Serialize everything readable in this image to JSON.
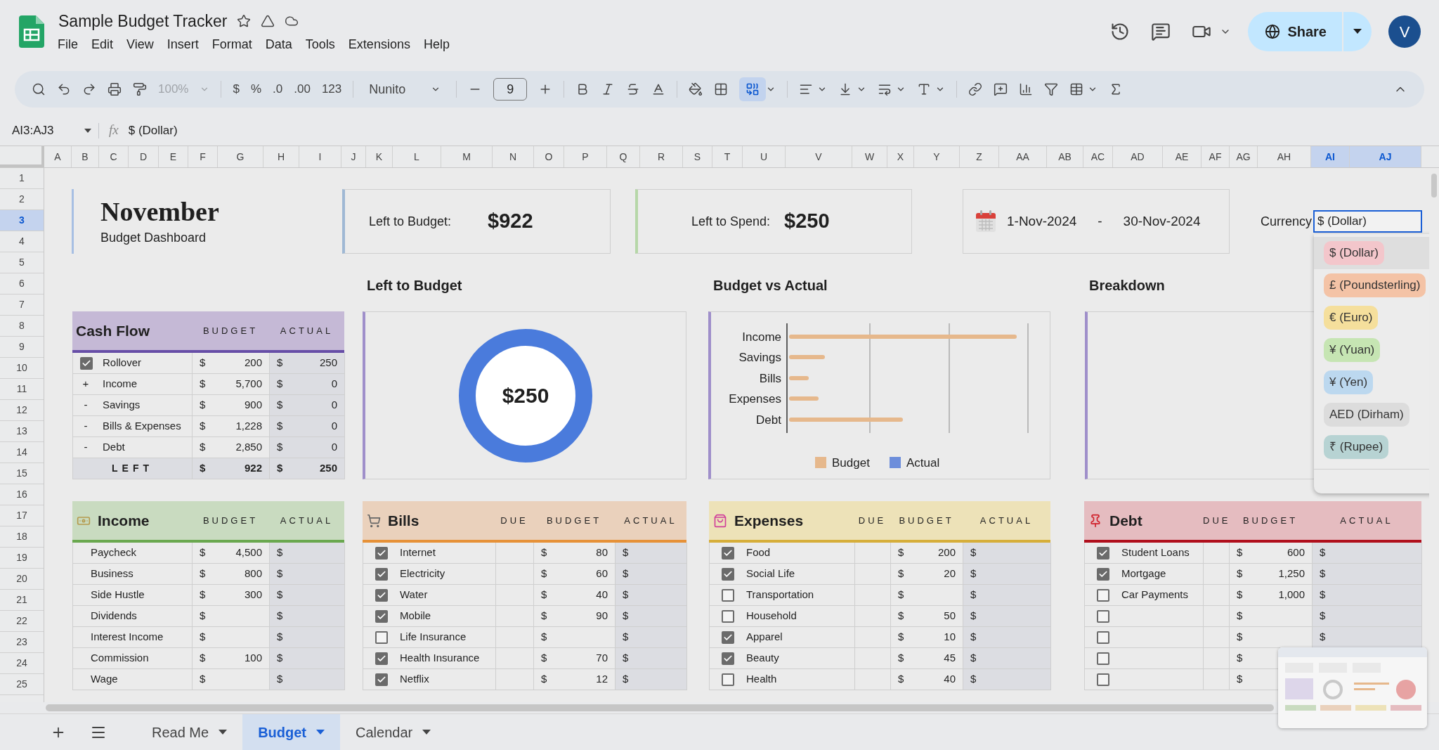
{
  "app": {
    "title": "Sample Budget Tracker",
    "menu": [
      "File",
      "Edit",
      "View",
      "Insert",
      "Format",
      "Data",
      "Tools",
      "Extensions",
      "Help"
    ],
    "share": "Share",
    "avatar": "V"
  },
  "toolbar": {
    "zoom": "100%",
    "currency": "$",
    "percent": "%",
    "decrease_decimals": ".0",
    "increase_decimals": ".00",
    "number_format": "123",
    "font": "Nunito",
    "font_size": "9",
    "merge_active": true
  },
  "formula_bar": {
    "name_box": "AI3:AJ3",
    "fx": "fx",
    "value": "$ (Dollar)"
  },
  "columns": [
    {
      "label": "A",
      "selected": false
    },
    {
      "label": "B",
      "selected": false
    },
    {
      "label": "C",
      "selected": false
    },
    {
      "label": "D",
      "selected": false
    },
    {
      "label": "E",
      "selected": false
    },
    {
      "label": "F",
      "selected": false
    },
    {
      "label": "G",
      "selected": false
    },
    {
      "label": "H",
      "selected": false
    },
    {
      "label": "I",
      "selected": false
    },
    {
      "label": "J",
      "selected": false
    },
    {
      "label": "K",
      "selected": false
    },
    {
      "label": "L",
      "selected": false
    },
    {
      "label": "M",
      "selected": false
    },
    {
      "label": "N",
      "selected": false
    },
    {
      "label": "O",
      "selected": false
    },
    {
      "label": "P",
      "selected": false
    },
    {
      "label": "Q",
      "selected": false
    },
    {
      "label": "R",
      "selected": false
    },
    {
      "label": "S",
      "selected": false
    },
    {
      "label": "T",
      "selected": false
    },
    {
      "label": "U",
      "selected": false
    },
    {
      "label": "V",
      "selected": false
    },
    {
      "label": "W",
      "selected": false
    },
    {
      "label": "X",
      "selected": false
    },
    {
      "label": "Y",
      "selected": false
    },
    {
      "label": "Z",
      "selected": false
    },
    {
      "label": "AA",
      "selected": false
    },
    {
      "label": "AB",
      "selected": false
    },
    {
      "label": "AC",
      "selected": false
    },
    {
      "label": "AD",
      "selected": false
    },
    {
      "label": "AE",
      "selected": false
    },
    {
      "label": "AF",
      "selected": false
    },
    {
      "label": "AG",
      "selected": false
    },
    {
      "label": "AH",
      "selected": false
    },
    {
      "label": "AI",
      "selected": true
    },
    {
      "label": "AJ",
      "selected": true
    }
  ],
  "rows": [
    {
      "label": "1",
      "selected": false
    },
    {
      "label": "2",
      "selected": false
    },
    {
      "label": "3",
      "selected": true
    },
    {
      "label": "4",
      "selected": false
    },
    {
      "label": "5",
      "selected": false
    },
    {
      "label": "6",
      "selected": false
    },
    {
      "label": "7",
      "selected": false
    },
    {
      "label": "8",
      "selected": false
    },
    {
      "label": "9",
      "selected": false
    },
    {
      "label": "10",
      "selected": false
    },
    {
      "label": "11",
      "selected": false
    },
    {
      "label": "12",
      "selected": false
    },
    {
      "label": "13",
      "selected": false
    },
    {
      "label": "14",
      "selected": false
    },
    {
      "label": "15",
      "selected": false
    },
    {
      "label": "16",
      "selected": false
    },
    {
      "label": "17",
      "selected": false
    },
    {
      "label": "18",
      "selected": false
    },
    {
      "label": "19",
      "selected": false
    },
    {
      "label": "20",
      "selected": false
    },
    {
      "label": "21",
      "selected": false
    },
    {
      "label": "22",
      "selected": false
    },
    {
      "label": "23",
      "selected": false
    },
    {
      "label": "24",
      "selected": false
    },
    {
      "label": "25",
      "selected": false
    }
  ],
  "dashboard": {
    "title": "November",
    "subtitle": "Budget Dashboard",
    "summary_cards": [
      {
        "label": "Left to Budget:",
        "value": "$922",
        "color": "#9fb8d4"
      },
      {
        "label": "Left to Spend:",
        "value": "$250",
        "color": "#b6d7a8"
      }
    ],
    "date_range": {
      "start": "1-Nov-2024",
      "separator": "-",
      "end": "30-Nov-2024"
    },
    "currency": {
      "label": "Currency",
      "value": "$ (Dollar)",
      "options": [
        {
          "label": "$ (Dollar)",
          "color": "#f3c6cb",
          "selected": true
        },
        {
          "label": "£ (Poundsterling)",
          "color": "#f4c3a6",
          "selected": false
        },
        {
          "label": "€ (Euro)",
          "color": "#f5df9c",
          "selected": false
        },
        {
          "label": "¥ (Yuan)",
          "color": "#c6e5b3",
          "selected": false
        },
        {
          "label": "¥ (Yen)",
          "color": "#bcd8ef",
          "selected": false
        },
        {
          "label": "AED (Dirham)",
          "color": "#dcdcdc",
          "selected": false
        },
        {
          "label": "₹ (Rupee)",
          "color": "#b7d3d3",
          "selected": false
        }
      ]
    },
    "section_titles": [
      "Left to Budget",
      "Budget vs Actual",
      "Breakdown"
    ],
    "cash_flow": {
      "title": "Cash Flow",
      "columns": [
        "BUDGET",
        "ACTUAL"
      ],
      "rows": [
        {
          "kind": "checkbox",
          "checked": true,
          "label": "Rollover",
          "budget_sym": "$",
          "budget": "200",
          "actual_sym": "$",
          "actual": "250"
        },
        {
          "kind": "sign",
          "sign": "+",
          "label": "Income",
          "budget_sym": "$",
          "budget": "5,700",
          "actual_sym": "$",
          "actual": "0"
        },
        {
          "kind": "sign",
          "sign": "-",
          "label": "Savings",
          "budget_sym": "$",
          "budget": "900",
          "actual_sym": "$",
          "actual": "0"
        },
        {
          "kind": "sign",
          "sign": "-",
          "label": "Bills & Expenses",
          "budget_sym": "$",
          "budget": "1,228",
          "actual_sym": "$",
          "actual": "0"
        },
        {
          "kind": "sign",
          "sign": "-",
          "label": "Debt",
          "budget_sym": "$",
          "budget": "2,850",
          "actual_sym": "$",
          "actual": "0"
        },
        {
          "kind": "total",
          "label": "LEFT",
          "budget_sym": "$",
          "budget": "922",
          "actual_sym": "$",
          "actual": "250"
        }
      ]
    },
    "donut": {
      "center": "$250"
    },
    "budget_vs_actual": {
      "categories": [
        "Income",
        "Savings",
        "Bills",
        "Expenses",
        "Debt"
      ],
      "legend": [
        {
          "label": "Budget",
          "color": "#e6b88c"
        },
        {
          "label": "Actual",
          "color": "#6d8edb"
        }
      ]
    },
    "tables": [
      {
        "kind": "income",
        "title": "Income",
        "color": "#c9dbc0",
        "columns": [
          "BUDGET",
          "ACTUAL"
        ],
        "rows": [
          {
            "label": "Paycheck",
            "budget_sym": "$",
            "budget": "4,500",
            "actual_sym": "$"
          },
          {
            "label": "Business",
            "budget_sym": "$",
            "budget": "800",
            "actual_sym": "$"
          },
          {
            "label": "Side Hustle",
            "budget_sym": "$",
            "budget": "300",
            "actual_sym": "$"
          },
          {
            "label": "Dividends",
            "budget_sym": "$",
            "actual_sym": "$"
          },
          {
            "label": "Interest Income",
            "budget_sym": "$",
            "actual_sym": "$"
          },
          {
            "label": "Commission",
            "budget_sym": "$",
            "budget": "100",
            "actual_sym": "$"
          },
          {
            "label": "Wage",
            "budget_sym": "$",
            "actual_sym": "$"
          }
        ]
      },
      {
        "kind": "bills",
        "title": "Bills",
        "color": "#ead1bc",
        "columns": [
          "DUE",
          "BUDGET",
          "ACTUAL"
        ],
        "rows": [
          {
            "checked": true,
            "label": "Internet",
            "budget_sym": "$",
            "budget": "80",
            "actual_sym": "$"
          },
          {
            "checked": true,
            "label": "Electricity",
            "budget_sym": "$",
            "budget": "60",
            "actual_sym": "$"
          },
          {
            "checked": true,
            "label": "Water",
            "budget_sym": "$",
            "budget": "40",
            "actual_sym": "$"
          },
          {
            "checked": true,
            "label": "Mobile",
            "budget_sym": "$",
            "budget": "90",
            "actual_sym": "$"
          },
          {
            "checked": false,
            "label": "Life Insurance",
            "budget_sym": "$",
            "actual_sym": "$"
          },
          {
            "checked": true,
            "label": "Health Insurance",
            "budget_sym": "$",
            "budget": "70",
            "actual_sym": "$"
          },
          {
            "checked": true,
            "label": "Netflix",
            "budget_sym": "$",
            "budget": "12",
            "actual_sym": "$"
          }
        ]
      },
      {
        "kind": "expenses",
        "title": "Expenses",
        "color": "#ede2b8",
        "columns": [
          "DUE",
          "BUDGET",
          "ACTUAL"
        ],
        "rows": [
          {
            "checked": true,
            "label": "Food",
            "budget_sym": "$",
            "budget": "200",
            "actual_sym": "$"
          },
          {
            "checked": true,
            "label": "Social Life",
            "budget_sym": "$",
            "budget": "20",
            "actual_sym": "$"
          },
          {
            "checked": false,
            "label": "Transportation",
            "budget_sym": "$",
            "actual_sym": "$"
          },
          {
            "checked": false,
            "label": "Household",
            "budget_sym": "$",
            "budget": "50",
            "actual_sym": "$"
          },
          {
            "checked": true,
            "label": "Apparel",
            "budget_sym": "$",
            "budget": "10",
            "actual_sym": "$"
          },
          {
            "checked": true,
            "label": "Beauty",
            "budget_sym": "$",
            "budget": "45",
            "actual_sym": "$"
          },
          {
            "checked": false,
            "label": "Health",
            "budget_sym": "$",
            "budget": "40",
            "actual_sym": "$"
          }
        ]
      },
      {
        "kind": "debt",
        "title": "Debt",
        "color": "#e5bcc0",
        "columns": [
          "DUE",
          "BUDGET",
          "ACTUAL"
        ],
        "rows": [
          {
            "checked": true,
            "label": "Student Loans",
            "budget_sym": "$",
            "budget": "600",
            "actual_sym": "$"
          },
          {
            "checked": true,
            "label": "Mortgage",
            "budget_sym": "$",
            "budget": "1,250",
            "actual_sym": "$"
          },
          {
            "checked": false,
            "label": "Car Payments",
            "budget_sym": "$",
            "budget": "1,000",
            "actual_sym": "$"
          },
          {
            "checked": false,
            "budget_sym": "$",
            "actual_sym": "$"
          },
          {
            "checked": false,
            "budget_sym": "$",
            "actual_sym": "$"
          },
          {
            "checked": false,
            "budget_sym": "$"
          },
          {
            "checked": false,
            "budget_sym": "$"
          }
        ]
      }
    ]
  },
  "sheet_tabs": [
    {
      "label": "Read Me",
      "selected": false
    },
    {
      "label": "Budget",
      "selected": true
    },
    {
      "label": "Calendar",
      "selected": false
    }
  ]
}
